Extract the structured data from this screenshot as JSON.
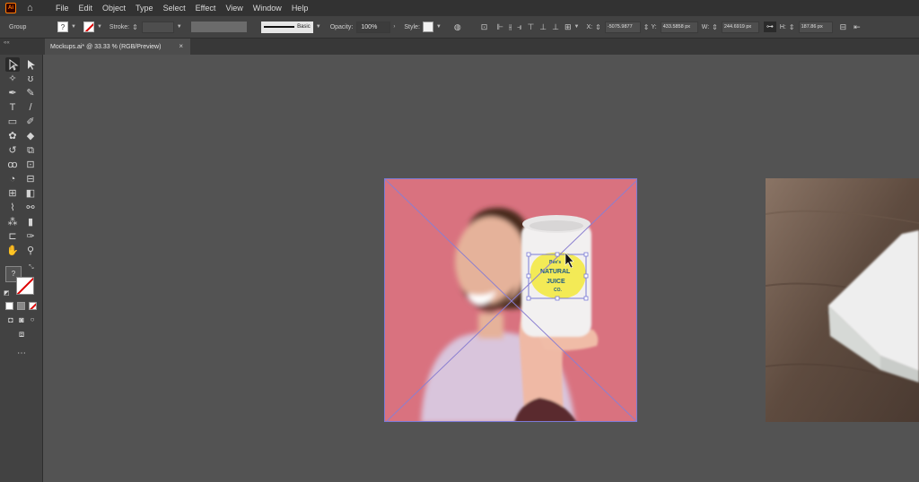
{
  "app": {
    "logo": "Ai"
  },
  "menu": [
    "File",
    "Edit",
    "Object",
    "Type",
    "Select",
    "Effect",
    "View",
    "Window",
    "Help"
  ],
  "control_bar": {
    "selection_type": "Group",
    "fill_label": "?",
    "stroke_label": "Stroke:",
    "brush_label": "Basic",
    "opacity_label": "Opacity:",
    "opacity_value": "100%",
    "style_label": "Style:",
    "x_label": "X:",
    "x_value": "-5075.9877",
    "y_label": "Y:",
    "y_value": "433.5858 px",
    "w_label": "W:",
    "w_value": "244.6919 px",
    "h_label": "H:",
    "h_value": "187.86 px"
  },
  "document_tab": {
    "title": "Mockups.ai* @ 33.33 % (RGB/Preview)",
    "close": "×"
  },
  "can_label": {
    "line1": "Bee's",
    "line2": "NATURAL",
    "line3": "JUICE",
    "line4": "CO."
  },
  "colors": {
    "menubar": "#323232",
    "panel": "#424242",
    "canvas": "#535353",
    "artboard_bg": "#d9727f",
    "selection": "#7b7bd6"
  },
  "icons": [
    "home-icon",
    "selection-tool-icon",
    "direct-selection-icon",
    "pen-tool-icon",
    "type-tool-icon",
    "rectangle-tool-icon",
    "hand-tool-icon",
    "zoom-tool-icon"
  ]
}
